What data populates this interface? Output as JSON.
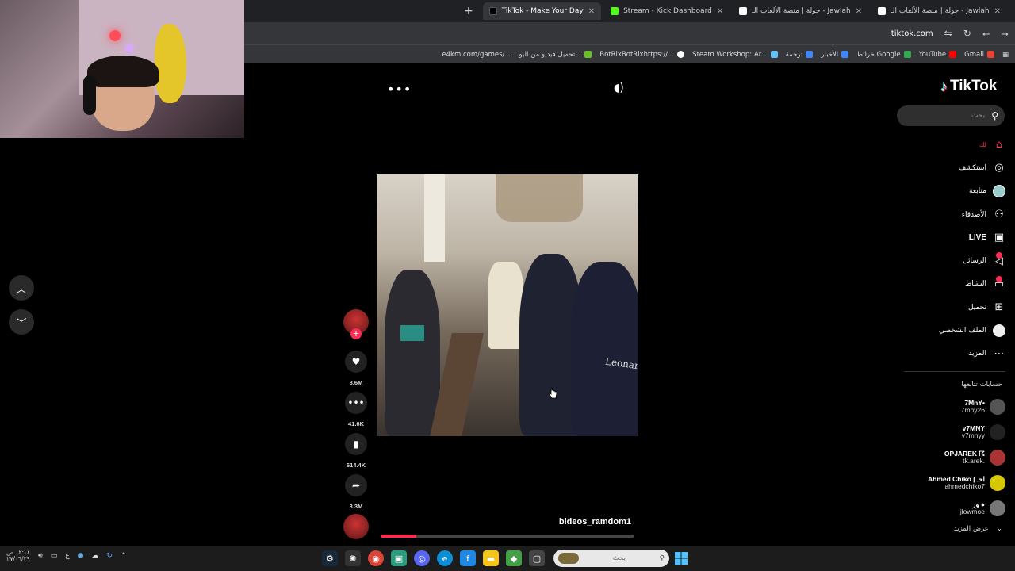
{
  "browser": {
    "tabs": [
      {
        "title": "جولة | منصة الألعاب الـ - Jawlah",
        "active": false
      },
      {
        "title": "جولة | منصة الألعاب الـ - Jawlah",
        "active": false
      },
      {
        "title": "Stream - Kick Dashboard",
        "active": false
      },
      {
        "title": "TikTok - Make Your Day",
        "active": true
      }
    ],
    "new_tab_label": "+",
    "url": "tiktok.com",
    "bookmarks": [
      {
        "label": "Gmail",
        "color": "#ea4335"
      },
      {
        "label": "YouTube",
        "color": "#ff0000"
      },
      {
        "label": "خرائط Google",
        "color": "#34a853"
      },
      {
        "label": "الأخبار",
        "color": "#4285f4"
      },
      {
        "label": "ترجمة",
        "color": "#4285f4"
      },
      {
        "label": "Steam Workshop::Ar...",
        "color": "#1b2838"
      },
      {
        "label": "BotRixBotRixhttps://...",
        "color": "#ffffff"
      },
      {
        "label": "تحميل فيديو من اليو...",
        "color": "#6abf2a"
      },
      {
        "label": "e4km.com/games/...",
        "color": "#ffffff"
      }
    ]
  },
  "tiktok": {
    "logo": "TikTok",
    "search_placeholder": "بحث",
    "nav": [
      {
        "label": "لك",
        "icon": "home-icon",
        "key": "home"
      },
      {
        "label": "استكشف",
        "icon": "compass-icon",
        "key": "explore"
      },
      {
        "label": "متابعة",
        "icon": "avatar-icon",
        "key": "following"
      },
      {
        "label": "الأصدقاء",
        "icon": "friends-icon",
        "key": "friends"
      },
      {
        "label": "LIVE",
        "icon": "live-icon",
        "key": "live"
      },
      {
        "label": "الرسائل",
        "icon": "messages-icon",
        "key": "messages"
      },
      {
        "label": "النشاط",
        "icon": "activity-icon",
        "key": "activity"
      },
      {
        "label": "تحميل",
        "icon": "upload-icon",
        "key": "upload"
      },
      {
        "label": "الملف الشخصي",
        "icon": "profile-icon",
        "key": "profile"
      },
      {
        "label": "المزيد",
        "icon": "more-icon",
        "key": "more"
      }
    ],
    "following_title": "حسابات تتابعها",
    "following_accounts": [
      {
        "display": "7MnY•",
        "handle": "7mny26",
        "color": "#555"
      },
      {
        "display": "v7MNY",
        "handle": "v7mnyy",
        "color": "#222"
      },
      {
        "display": "OPJAREK ☈",
        "handle": "tk.arek.",
        "color": "#a33"
      },
      {
        "display": "Ahmed Chiko | احـ",
        "handle": "ahmedchiko7",
        "color": "#d6c800"
      },
      {
        "display": "ور ●",
        "handle": "jlowmoe",
        "color": "#777"
      }
    ],
    "see_more": "عرض المزيد",
    "video": {
      "username": "bideos_ramdom1",
      "shirt_text": "Leonard",
      "progress": 0.14,
      "likes": "8.6M",
      "comments": "41.6K",
      "saves": "614.4K",
      "shares": "3.3M"
    }
  },
  "taskbar": {
    "search_placeholder": "بحث",
    "time": "٠٢:٠٤ ص",
    "date": "٢٧/٠٦/٢٩",
    "lang": "ع"
  }
}
